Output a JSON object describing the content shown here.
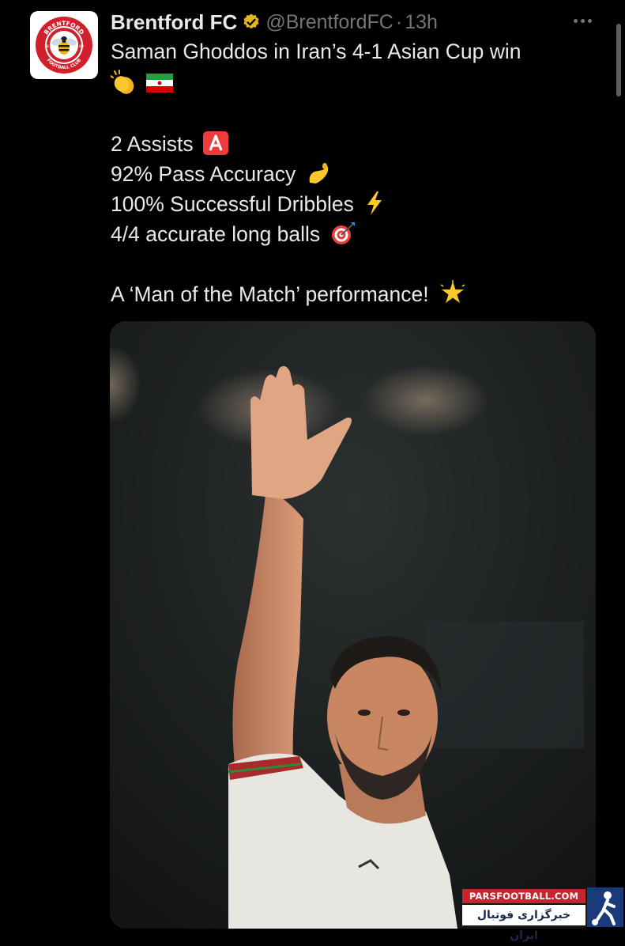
{
  "tweet": {
    "display_name": "Brentford FC",
    "handle": "@BrentfordFC",
    "separator": "·",
    "time": "13h",
    "text_line_1": "Saman Ghoddos in Iran’s 4-1 Asian Cup win",
    "stats": [
      "2 Assists",
      "92% Pass Accuracy",
      "100% Successful Dribbles",
      "4/4 accurate long balls"
    ],
    "closing": "A ‘Man of the Match’ performance!"
  },
  "avatar": {
    "crest_top": "BRENTFORD",
    "crest_bottom": "FOOTBALL CLUB",
    "year_left": "18",
    "year_right": "89"
  },
  "watermark": {
    "site": "PARSFOOTBALL.COM",
    "tagline": "خبرگزاری فوتبال ایران"
  },
  "icons": {
    "verified": "verified-badge-icon",
    "more": "more-options-icon",
    "clap": "clapping-hands-emoji",
    "flag": "iran-flag-emoji",
    "a_button": "a-button-emoji",
    "pinch": "pinching-hand-emoji",
    "zap": "high-voltage-emoji",
    "target": "direct-hit-emoji",
    "star": "glowing-star-emoji"
  },
  "colors": {
    "background": "#000000",
    "text": "#e7e9ea",
    "secondary": "#71767b",
    "verified_gold": "#e2b719",
    "brentford_red": "#d0202b"
  }
}
